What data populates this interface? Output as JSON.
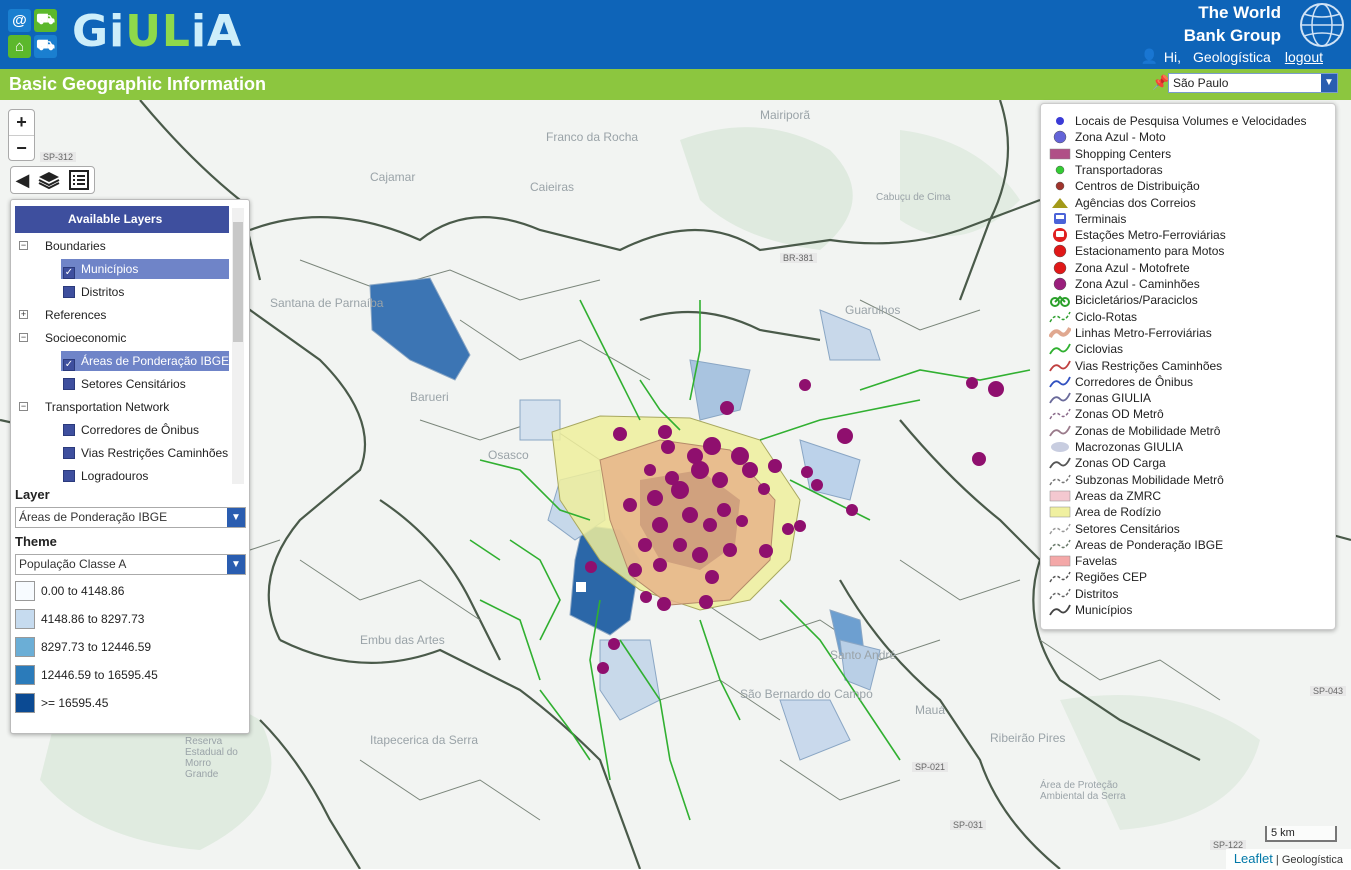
{
  "app": {
    "logo_prefix": "Gi",
    "logo_accent": "UL",
    "logo_suffix": "iA",
    "org_line1": "The World",
    "org_line2": "Bank Group",
    "greeting": "Hi,",
    "user_name": "Geologística",
    "logout_label": "logout"
  },
  "titlebar": {
    "title": "Basic Geographic Information",
    "city": "São Paulo"
  },
  "map": {
    "zoom_in": "+",
    "zoom_out": "−",
    "scale_label": "5 km",
    "attribution_leaflet": "Leaflet",
    "attribution_sep": "|",
    "attribution_source": "Geologística",
    "place_labels": [
      "Franco da Rocha",
      "Cajamar",
      "Caieiras",
      "Santana de Parnaíba",
      "Guarulhos",
      "Osasco",
      "Embu das Artes",
      "Santo André",
      "Mauá",
      "São Bernardo do Campo",
      "Itapecerica da Serra",
      "Ribeirão Pires",
      "Reserva Estadual do Morro Grande",
      "Área de Proteção Ambiental da Serra",
      "Mairiporã",
      "Cabuçu de Cima",
      "Barueri"
    ],
    "road_labels": [
      "SP-312",
      "BR-381",
      "SP-043",
      "SP-031",
      "SP-122",
      "SP-021"
    ]
  },
  "layers_panel": {
    "header": "Available Layers",
    "tree": [
      {
        "type": "group",
        "label": "Boundaries",
        "expander": "−"
      },
      {
        "type": "layer",
        "label": "Municípios",
        "checked": true,
        "selected": true
      },
      {
        "type": "layer",
        "label": "Distritos",
        "checked": false,
        "selected": false
      },
      {
        "type": "group",
        "label": "References",
        "expander": "+"
      },
      {
        "type": "group",
        "label": "Socioeconomic",
        "expander": "−"
      },
      {
        "type": "layer",
        "label": "Áreas de Ponderação IBGE",
        "checked": true,
        "selected": true
      },
      {
        "type": "layer",
        "label": "Setores Censitários",
        "checked": false,
        "selected": false
      },
      {
        "type": "group",
        "label": "Transportation Network",
        "expander": "−"
      },
      {
        "type": "layer",
        "label": "Corredores de Ônibus",
        "checked": false,
        "selected": false
      },
      {
        "type": "layer",
        "label": "Vias Restrições Caminhões",
        "checked": false,
        "selected": false
      },
      {
        "type": "layer",
        "label": "Logradouros",
        "checked": false,
        "selected": false
      }
    ],
    "layer_label": "Layer",
    "layer_value": "Áreas de Ponderação IBGE",
    "theme_label": "Theme",
    "theme_value": "População Classe A",
    "classes": [
      {
        "label": "0.00 to 4148.86",
        "color": "#f7fbff"
      },
      {
        "label": "4148.86 to 8297.73",
        "color": "#c6dbef"
      },
      {
        "label": "8297.73 to 12446.59",
        "color": "#6baed6"
      },
      {
        "label": "12446.59 to 16595.45",
        "color": "#2b7bba"
      },
      {
        "label": ">= 16595.45",
        "color": "#0b4a93"
      }
    ]
  },
  "legend": [
    {
      "label": "Locais de Pesquisa Volumes e Velocidades",
      "icon": "small-blue-dot",
      "color": "#3b3bd6"
    },
    {
      "label": "Zona Azul - Moto",
      "icon": "blue-dot",
      "color": "#6464d8"
    },
    {
      "label": "Shopping Centers",
      "icon": "rect",
      "color": "#b04f86"
    },
    {
      "label": "Transportadoras",
      "icon": "green-dot",
      "color": "#33cc33"
    },
    {
      "label": "Centros de Distribuição",
      "icon": "brown-dot",
      "color": "#a0342c"
    },
    {
      "label": "Agências dos Correios",
      "icon": "triangle",
      "color": "#a39a1a"
    },
    {
      "label": "Terminais",
      "icon": "bus-icon",
      "color": "#4b63d8"
    },
    {
      "label": "Estações Metro-Ferroviárias",
      "icon": "train-icon",
      "color": "#e02020"
    },
    {
      "label": "Estacionamento para Motos",
      "icon": "red-dot",
      "color": "#e01818"
    },
    {
      "label": "Zona Azul - Motofrete",
      "icon": "red-dot",
      "color": "#e01818"
    },
    {
      "label": "Zona Azul - Caminhões",
      "icon": "purple-dot",
      "color": "#9a1f7c"
    },
    {
      "label": "Bicicletários/Paraciclos",
      "icon": "bike-icon",
      "color": "#2aa02a"
    },
    {
      "label": "Ciclo-Rotas",
      "icon": "dashed-line",
      "color": "#30a030"
    },
    {
      "label": "Linhas Metro-Ferroviárias",
      "icon": "thick-line",
      "color": "#e0a890"
    },
    {
      "label": "Ciclovias",
      "icon": "line",
      "color": "#30b030"
    },
    {
      "label": "Vias Restrições Caminhões",
      "icon": "line",
      "color": "#c04040"
    },
    {
      "label": "Corredores de Ônibus",
      "icon": "line",
      "color": "#3050c0"
    },
    {
      "label": "Zonas GIULIA",
      "icon": "line",
      "color": "#6a6a9a"
    },
    {
      "label": "Zonas OD Metrô",
      "icon": "dashed-line",
      "color": "#8a6a8a"
    },
    {
      "label": "Zonas de Mobilidade Metrô",
      "icon": "line",
      "color": "#9a7a8a"
    },
    {
      "label": "Macrozonas GIULIA",
      "icon": "ellipse",
      "color": "#c8cde0"
    },
    {
      "label": "Zonas OD Carga",
      "icon": "line",
      "color": "#555555"
    },
    {
      "label": "Subzonas Mobilidade Metrô",
      "icon": "dashed-line",
      "color": "#777777"
    },
    {
      "label": "Areas da ZMRC",
      "icon": "rect",
      "color": "#f4c8d0"
    },
    {
      "label": "Area de Rodízio",
      "icon": "rect",
      "color": "#f0f0a0"
    },
    {
      "label": "Setores Censitários",
      "icon": "dashed-line",
      "color": "#999999"
    },
    {
      "label": "Areas de Ponderação IBGE",
      "icon": "dashed-line",
      "color": "#6a7a6a"
    },
    {
      "label": "Favelas",
      "icon": "rect",
      "color": "#f4a8a8"
    },
    {
      "label": "Regiões CEP",
      "icon": "dashed-line",
      "color": "#555555"
    },
    {
      "label": "Distritos",
      "icon": "dashed-line",
      "color": "#666666"
    },
    {
      "label": "Municípios",
      "icon": "line",
      "color": "#444444"
    }
  ]
}
